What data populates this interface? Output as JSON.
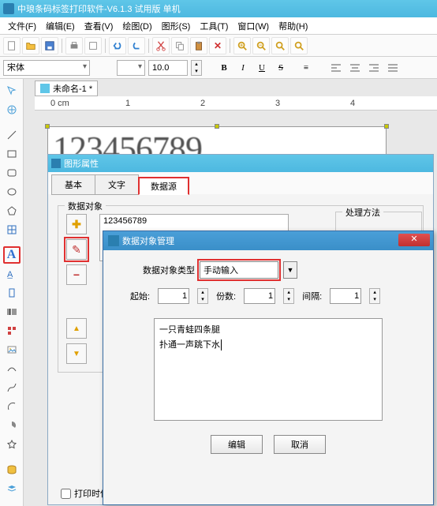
{
  "app": {
    "title": "中琅条码标签打印软件-V6.1.3 试用版 单机"
  },
  "menu": {
    "file": "文件(F)",
    "edit": "编辑(E)",
    "view": "查看(V)",
    "draw": "绘图(D)",
    "shape": "图形(S)",
    "tool": "工具(T)",
    "window": "窗口(W)",
    "help": "帮助(H)"
  },
  "font": {
    "name": "宋体",
    "size": "10.0"
  },
  "fmt": {
    "bold": "B",
    "italic": "I",
    "underline": "U",
    "strike": "S"
  },
  "doc": {
    "tab": "未命名-1 *"
  },
  "ruler": {
    "t0": "0 cm",
    "t1": "1",
    "t2": "2",
    "t3": "3",
    "t4": "4"
  },
  "canvas": {
    "text": "123456789"
  },
  "props": {
    "title": "图形属性",
    "tabs": {
      "basic": "基本",
      "text": "文字",
      "datasource": "数据源"
    },
    "group_obj": "数据对象",
    "group_proc": "处理方法",
    "objvalue": "123456789",
    "chk_save": "打印时保存"
  },
  "dlg": {
    "title": "数据对象管理",
    "type_label": "数据对象类型",
    "type_value": "手动输入",
    "start": "起始:",
    "copies": "份数:",
    "gap": "间隔:",
    "start_v": "1",
    "copies_v": "1",
    "gap_v": "1",
    "content": "一只青蛙四条腿\n扑通一声跳下水",
    "edit": "编辑",
    "cancel": "取消",
    "close": "✕"
  },
  "icons": {
    "plus": "✚",
    "pencil": "✎",
    "minus": "−",
    "up": "▲",
    "down": "▼",
    "text": "A"
  }
}
